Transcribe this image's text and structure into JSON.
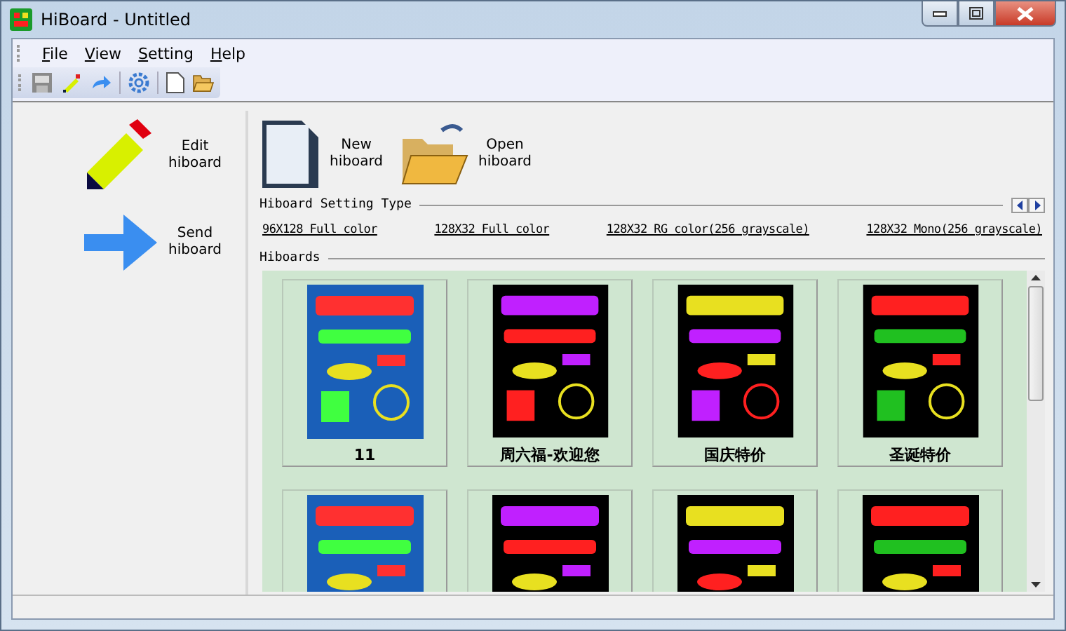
{
  "window": {
    "title": "HiBoard - Untitled"
  },
  "menu": [
    {
      "label": "File"
    },
    {
      "label": "View"
    },
    {
      "label": "Setting"
    },
    {
      "label": "Help"
    }
  ],
  "side_actions": [
    {
      "kind": "edit",
      "label": "Edit hiboard"
    },
    {
      "kind": "send",
      "label": "Send hiboard"
    }
  ],
  "top_actions": [
    {
      "kind": "new",
      "label": "New hiboard"
    },
    {
      "kind": "open",
      "label": "Open hiboard"
    }
  ],
  "setting_type": {
    "heading": "Hiboard Setting Type",
    "links": [
      "96X128 Full color",
      "128X32 Full color",
      "128X32 RG color(256 grayscale)",
      "128X32 Mono(256 grayscale)"
    ]
  },
  "hiboards": {
    "heading": "Hiboards",
    "items": [
      {
        "kind": "picture",
        "label": "11"
      },
      {
        "kind": "picture",
        "label": "周六福-欢迎您"
      },
      {
        "kind": "picture",
        "label": "国庆特价"
      },
      {
        "kind": "picture",
        "label": "圣诞特价"
      },
      {
        "kind": "picture"
      },
      {
        "kind": "picture"
      },
      {
        "kind": "picture"
      },
      {
        "kind": "picture"
      }
    ]
  }
}
